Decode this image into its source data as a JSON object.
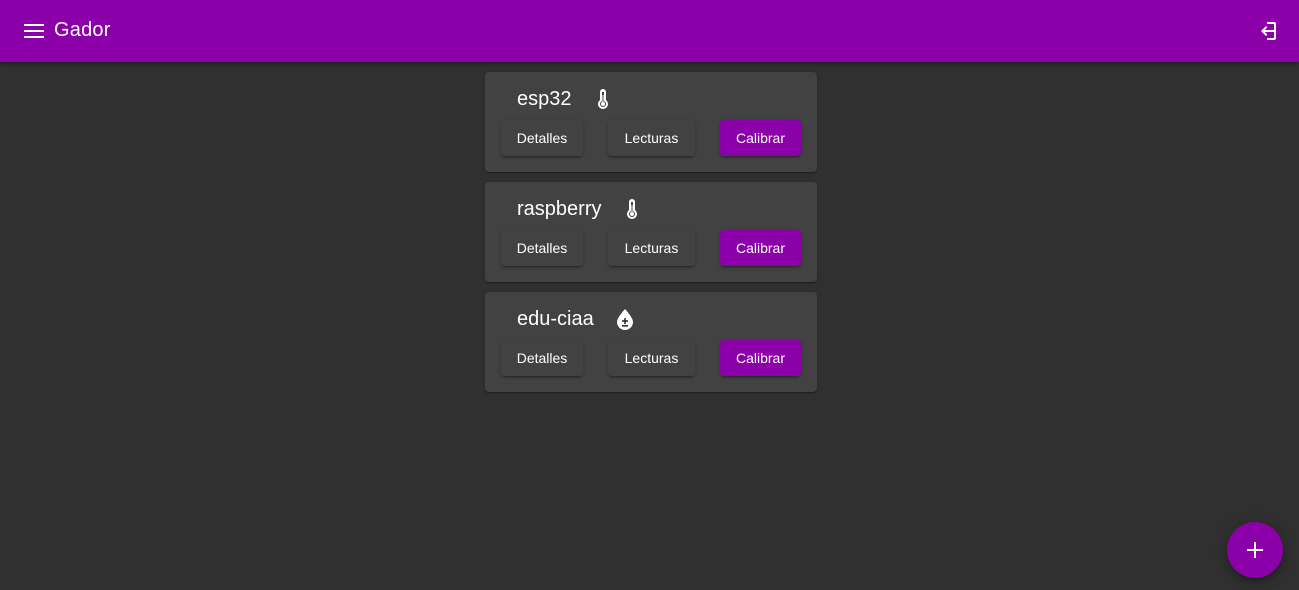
{
  "app": {
    "title": "Gador"
  },
  "colors": {
    "primary": "#8b00a8",
    "background": "#303030",
    "card": "#424242"
  },
  "header": {
    "menu_icon": "menu-icon",
    "login_icon": "login-icon"
  },
  "devices": [
    {
      "name": "esp32",
      "sensor_icon": "thermometer-icon",
      "details_label": "Detalles",
      "readings_label": "Lecturas",
      "calibrate_label": "Calibrar"
    },
    {
      "name": "raspberry",
      "sensor_icon": "thermometer-icon",
      "details_label": "Detalles",
      "readings_label": "Lecturas",
      "calibrate_label": "Calibrar"
    },
    {
      "name": "edu-ciaa",
      "sensor_icon": "water-drop-icon",
      "details_label": "Detalles",
      "readings_label": "Lecturas",
      "calibrate_label": "Calibrar"
    }
  ],
  "fab": {
    "icon": "plus-icon"
  }
}
